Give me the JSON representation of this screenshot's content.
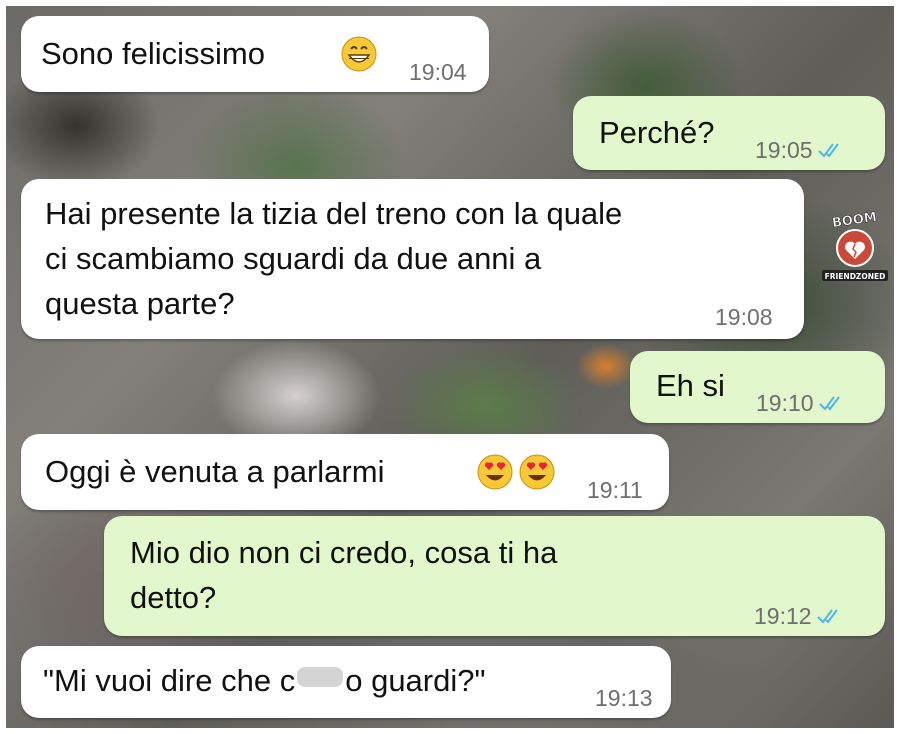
{
  "messages": [
    {
      "text": "Sono felicissimo",
      "time": "19:04",
      "direction": "incoming",
      "emoji": [
        "grinning-face"
      ]
    },
    {
      "text": "Perché?",
      "time": "19:05",
      "direction": "outgoing",
      "status": "read"
    },
    {
      "lines": [
        "Hai presente la tizia del treno con la quale",
        "ci scambiamo sguardi da due anni a",
        "questa parte?"
      ],
      "time": "19:08",
      "direction": "incoming"
    },
    {
      "text": "Eh si",
      "time": "19:10",
      "direction": "outgoing",
      "status": "read"
    },
    {
      "text": "Oggi è venuta a parlarmi",
      "time": "19:11",
      "direction": "incoming",
      "emoji": [
        "heart-eyes-face",
        "heart-eyes-face"
      ]
    },
    {
      "lines": [
        "Mio dio non ci credo, cosa ti ha",
        "detto?"
      ],
      "time": "19:12",
      "direction": "outgoing",
      "status": "read"
    },
    {
      "text_before": "\"Mi vuoi dire che c",
      "text_after": "o guardi?\"",
      "time": "19:13",
      "direction": "incoming",
      "censored": true
    }
  ],
  "watermark": {
    "top": "BOOM",
    "bottom": "FRIENDZONED"
  },
  "colors": {
    "incoming_bubble": "#ffffff",
    "outgoing_bubble": "#e2f7cb",
    "read_ticks": "#4fb6ec",
    "timestamp": "#6f6f6f"
  }
}
